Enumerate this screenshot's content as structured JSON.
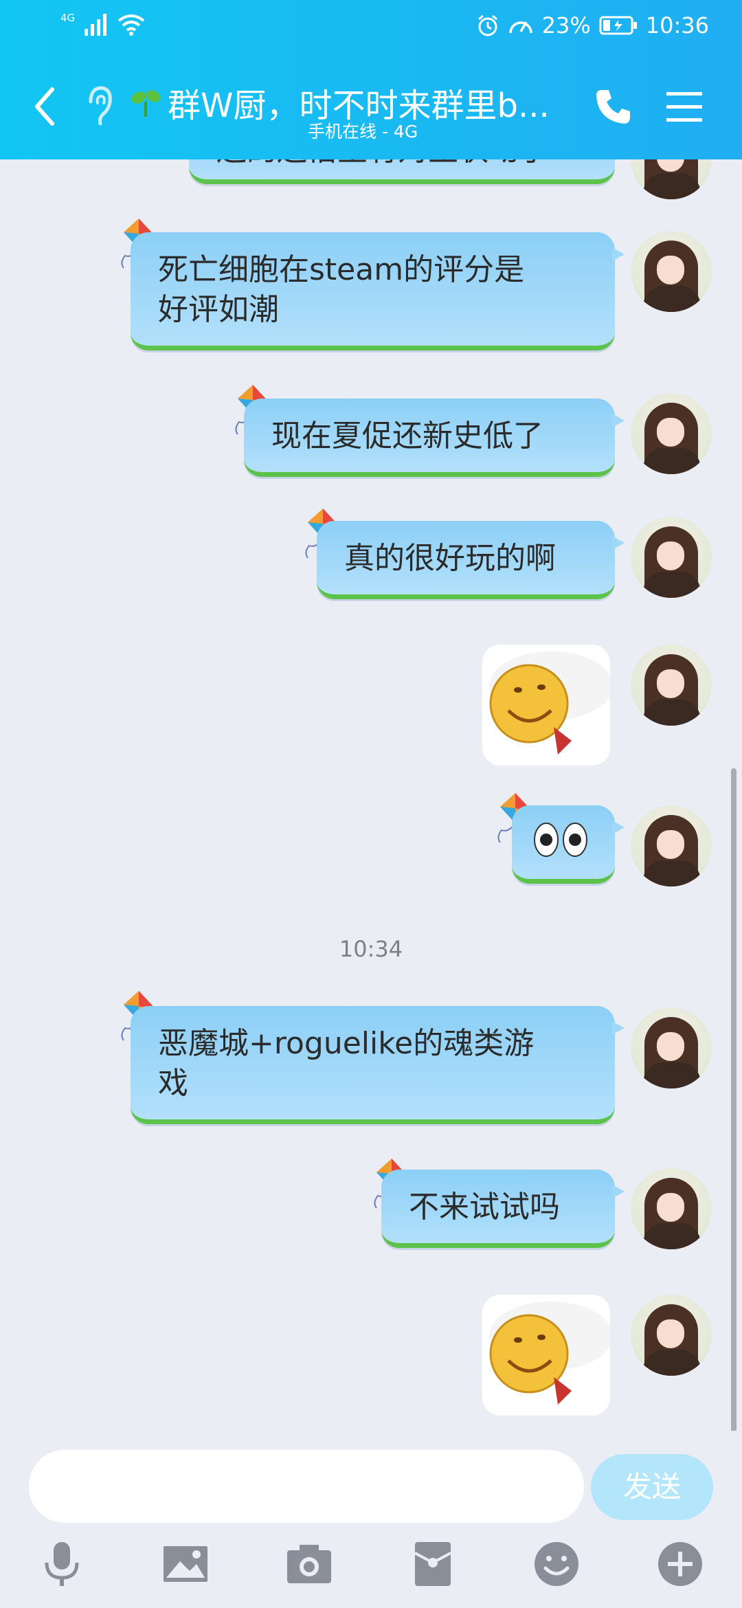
{
  "status_bar": {
    "network": "4G",
    "battery": "23%",
    "time": "10:36"
  },
  "header": {
    "title": "群W厨，时不时来群里b...",
    "subtitle": "手机在线 - 4G"
  },
  "messages": [
    {
      "type": "text",
      "text": "还的还悟里有对生状动了"
    },
    {
      "type": "text",
      "text": "死亡细胞在steam的评分是好评如潮",
      "line1": "死亡细胞在steam的评分是",
      "line2": "好评如潮"
    },
    {
      "type": "text",
      "text": "现在夏促还新史低了"
    },
    {
      "type": "text",
      "text": "真的很好玩的啊"
    },
    {
      "type": "sticker",
      "icon": "smiley-sticker"
    },
    {
      "type": "emoji",
      "icon": "eyes-emoji"
    },
    {
      "type": "text",
      "text": "恶魔城+roguelike的魂类游戏",
      "line1": "恶魔城+roguelike的魂类游",
      "line2": "戏"
    },
    {
      "type": "text",
      "text": "不来试试吗"
    },
    {
      "type": "sticker",
      "icon": "smiley-sticker"
    }
  ],
  "timestamp": "10:34",
  "input": {
    "value": "",
    "send_label": "发送"
  },
  "toolbar": [
    "microphone-icon",
    "image-icon",
    "camera-icon",
    "red-packet-icon",
    "emoji-icon",
    "plus-icon"
  ],
  "colors": {
    "header": "#20aef2",
    "bubble": "#a0d8f8",
    "bubble_border": "#5bc24a",
    "background": "#ebedf5",
    "send_button": "#b3e6fb"
  }
}
